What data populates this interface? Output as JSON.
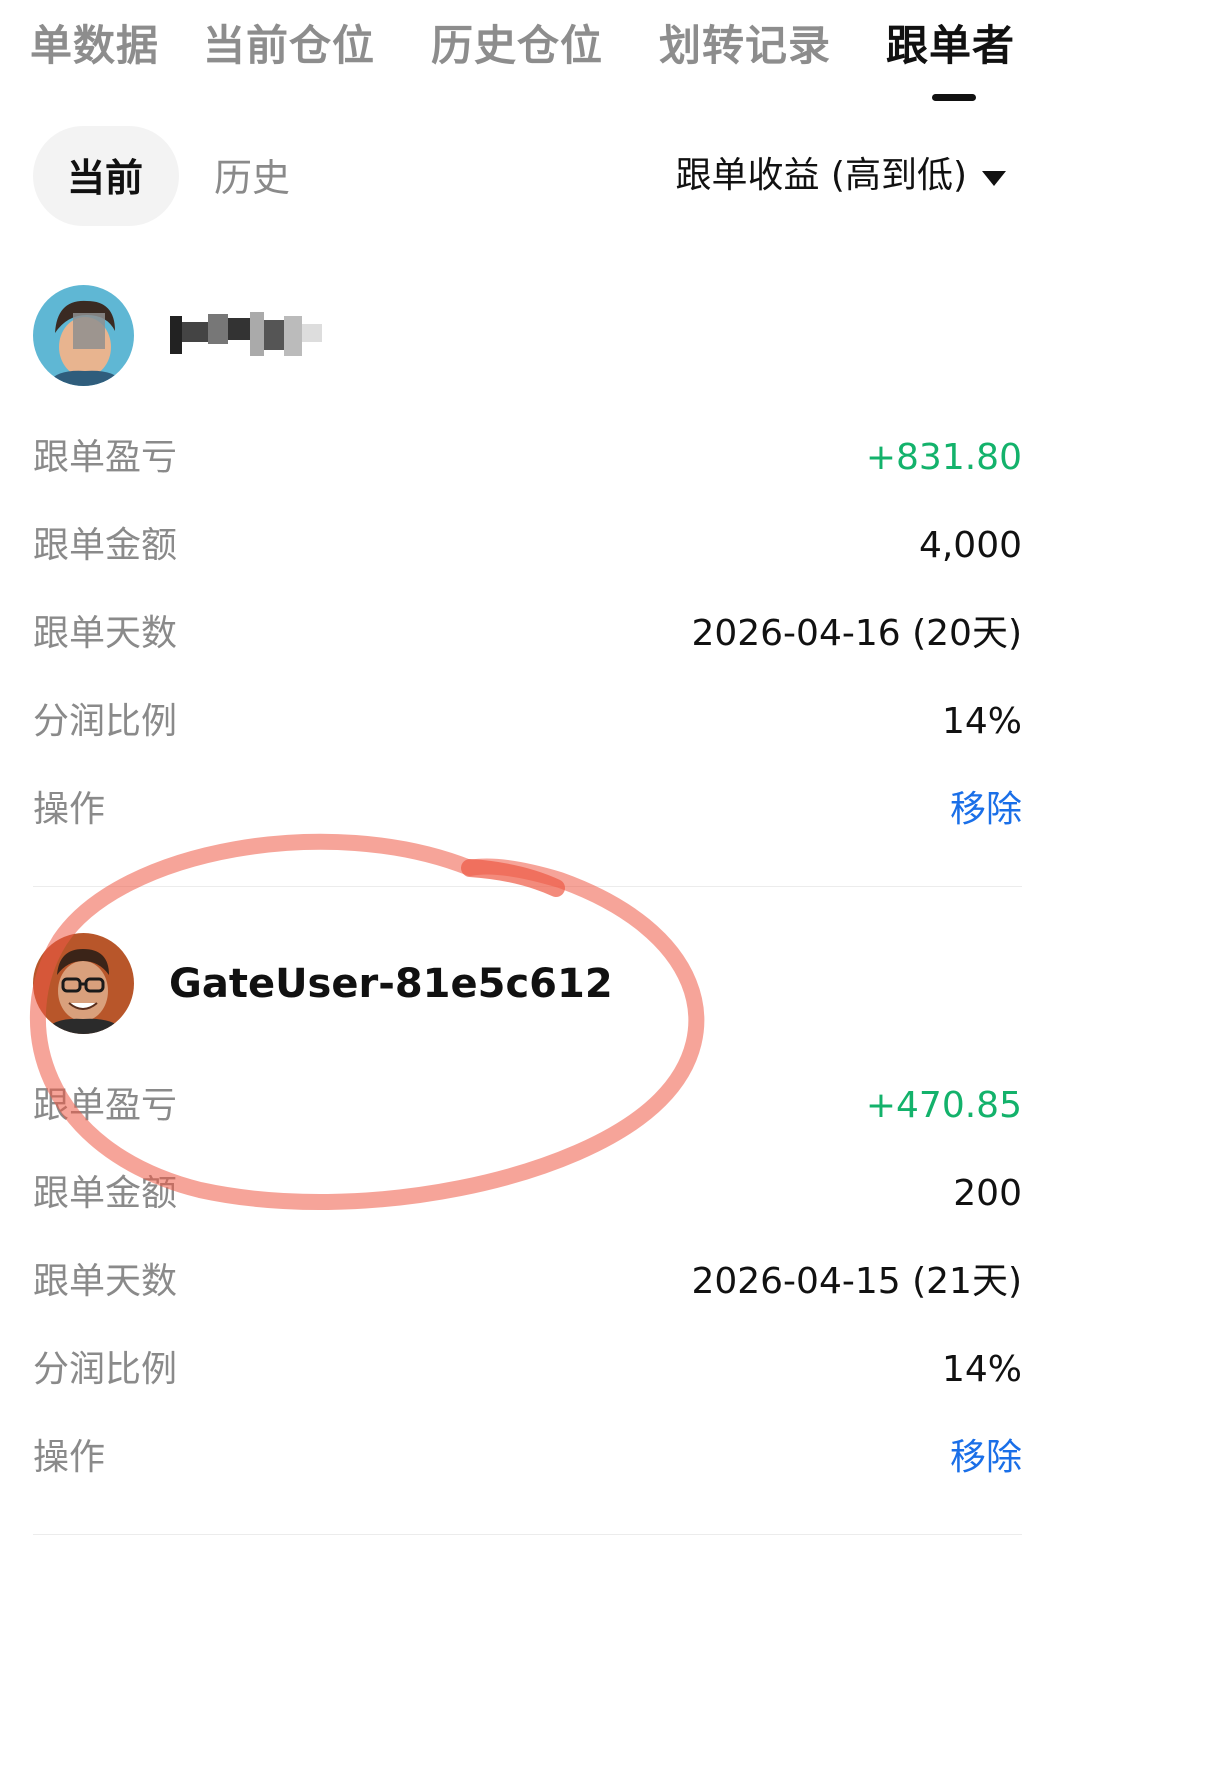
{
  "top_tabs": {
    "items": [
      {
        "label": "单数据"
      },
      {
        "label": "当前仓位"
      },
      {
        "label": "历史仓位"
      },
      {
        "label": "划转记录"
      },
      {
        "label": "跟单者"
      }
    ],
    "active_index": 4
  },
  "sub_tabs": {
    "current": "当前",
    "history": "历史"
  },
  "sort": {
    "label": "跟单收益 (高到低)"
  },
  "followers": [
    {
      "username": "",
      "username_obscured": true,
      "rows": [
        {
          "label": "跟单盈亏",
          "value": "+831.80"
        },
        {
          "label": "跟单金额",
          "value": "4,000"
        },
        {
          "label": "跟单天数",
          "value": "2026-04-16 (20天)"
        },
        {
          "label": "分润比例",
          "value": "14%"
        },
        {
          "label": "操作",
          "value": "移除"
        }
      ]
    },
    {
      "username": "GateUser-81e5c612",
      "username_obscured": false,
      "rows": [
        {
          "label": "跟单盈亏",
          "value": "+470.85"
        },
        {
          "label": "跟单金额",
          "value": "200"
        },
        {
          "label": "跟单天数",
          "value": "2026-04-15 (21天)"
        },
        {
          "label": "分润比例",
          "value": "14%"
        },
        {
          "label": "操作",
          "value": "移除"
        }
      ]
    }
  ],
  "colors": {
    "profit": "#13b26b",
    "action": "#1a6fe8",
    "label": "#8a8a8a",
    "annotation": "#ee5a45"
  },
  "icons": [
    "sort-caret-icon",
    "avatar-image",
    "annotation-circle"
  ]
}
